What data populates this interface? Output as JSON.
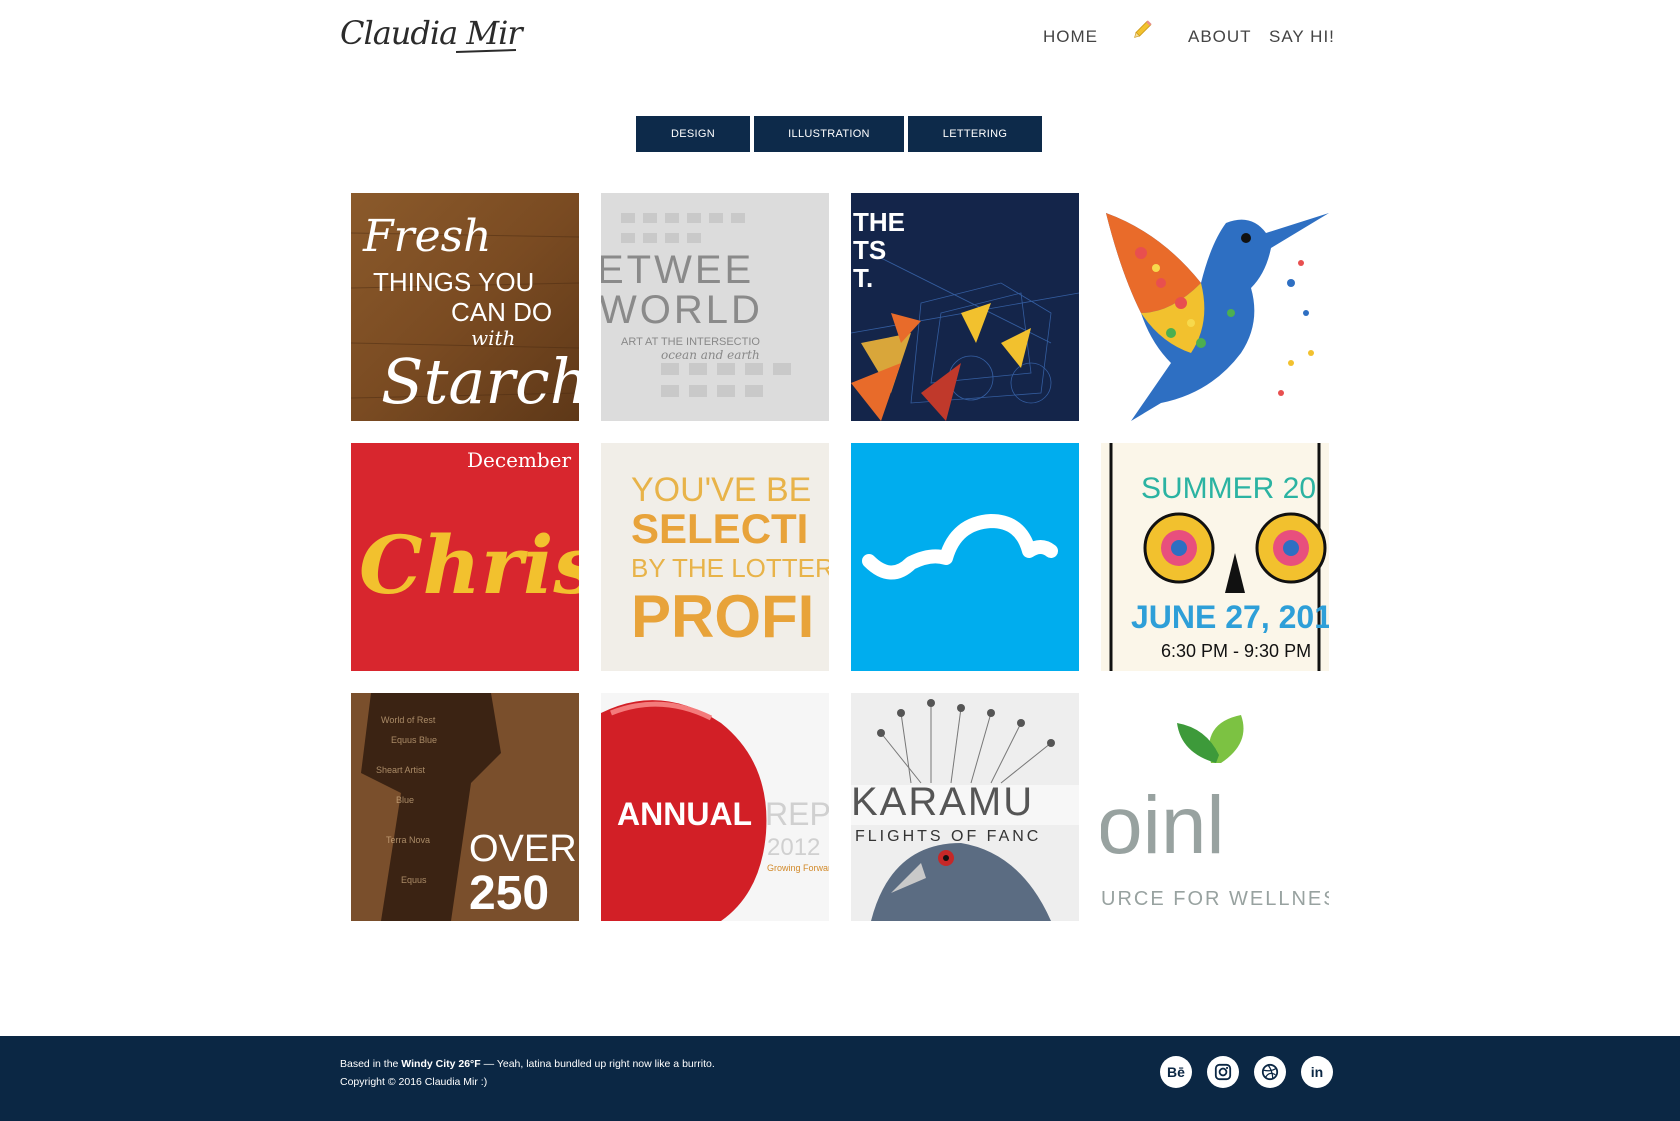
{
  "site": {
    "logo_text": "Claudia Mir"
  },
  "nav": {
    "home": "HOME",
    "about": "ABOUT",
    "say_hi": "SAY HI!"
  },
  "icons": {
    "nav_pencil": "pencil-icon",
    "social": [
      "behance-icon",
      "instagram-icon",
      "dribbble-icon",
      "linkedin-icon"
    ]
  },
  "filters": [
    "DESIGN",
    "ILLUSTRATION",
    "LETTERING"
  ],
  "tiles": {
    "t1": [
      "Fresh",
      "THINGS YOU",
      "CAN DO",
      "with",
      "Starch"
    ],
    "t2": [
      "ETWEE",
      "WORLD",
      "ART AT THE INTERSECTIO",
      "ocean and earth"
    ],
    "t3": [
      "THE",
      "TS",
      "T."
    ],
    "t5": [
      "December",
      "Chris"
    ],
    "t6": [
      "YOU'VE BE",
      "SELECTI",
      "BY THE LOTTER",
      "PROFI"
    ],
    "t8": [
      "SUMMER 20",
      "JUNE 27, 201",
      "6:30 PM - 9:30 PM"
    ],
    "t9": [
      "OVER",
      "250"
    ],
    "t10": [
      "ANNUAL",
      "REP",
      "2012",
      "Growing Forward"
    ],
    "t11": [
      "KARAMU",
      "FLIGHTS OF FANC"
    ],
    "t12": [
      "oinl",
      "URCE FOR WELLNES"
    ]
  },
  "footer": {
    "line1_pre": "Based in the ",
    "line1_bold": "Windy City 26°F",
    "line1_post": " — Yeah, latina bundled up right now like a burrito.",
    "line2": "Copyright © 2016 Claudia Mir :)",
    "social_labels": [
      "Bē",
      "◎",
      "◍",
      "in"
    ]
  },
  "colors": {
    "navy": "#0b2744",
    "filter_bg": "#0d2a4a",
    "cyan_tile": "#00adee",
    "red_tile": "#d8262e"
  }
}
